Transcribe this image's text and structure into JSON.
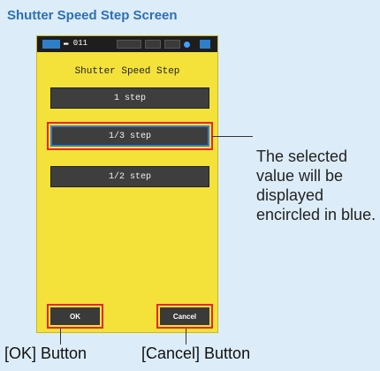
{
  "heading": "Shutter Speed Step Screen",
  "status_bar": {
    "text": "▬ 011"
  },
  "screen": {
    "title": "Shutter Speed Step",
    "options": [
      {
        "label": "1 step",
        "selected": false
      },
      {
        "label": "1/3 step",
        "selected": true
      },
      {
        "label": "1/2 step",
        "selected": false
      }
    ],
    "ok_label": "OK",
    "cancel_label": "Cancel"
  },
  "annotations": {
    "selected_note": "The selected value will be displayed encircled in blue.",
    "ok_caption": "[OK] Button",
    "cancel_caption": "[Cancel] Button"
  },
  "colors": {
    "panel_bg": "#dcecf8",
    "heading": "#2e6fb6",
    "device_bg": "#f4e23a",
    "highlight_red": "#e8262a",
    "selected_blue": "#3a7ad0"
  }
}
